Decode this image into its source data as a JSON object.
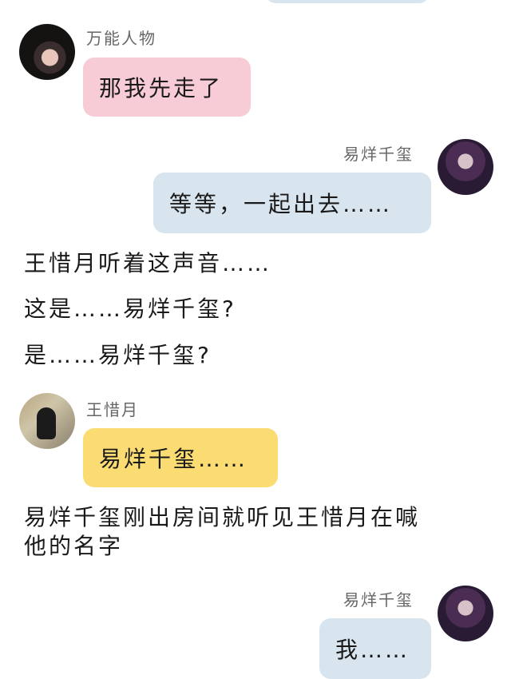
{
  "messages": [
    {
      "sender": "万能人物",
      "text": "那我先走了"
    },
    {
      "sender": "易烊千玺",
      "text": "等等，一起出去……"
    },
    {
      "sender": "王惜月",
      "text": "易烊千玺……"
    },
    {
      "sender": "易烊千玺",
      "text": "我……"
    }
  ],
  "narration": [
    "王惜月听着这声音……",
    "这是……易烊千玺?",
    "是……易烊千玺?",
    "易烊千玺刚出房间就听见王惜月在喊",
    "他的名字"
  ],
  "colors": {
    "pink_bubble": "#f8ccd6",
    "blue_bubble": "#d8e4ee",
    "yellow_bubble": "#fbdc72"
  }
}
